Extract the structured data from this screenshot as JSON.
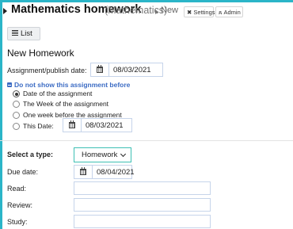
{
  "header": {
    "title": "Mathematics homework",
    "subject": "(Mathematics)",
    "crumb": "New",
    "settings_label": "Settings",
    "admin_label": "Admin",
    "settings_icon": "wrench-icon",
    "admin_icon": "users-icon"
  },
  "toolbar": {
    "list_label": "List"
  },
  "form": {
    "section_title": "New Homework",
    "publish_label": "Assignment/publish date:",
    "publish_date": "08/03/2021",
    "visibility_toggle": "Do not show this assignment before",
    "visibility_options": [
      {
        "label": "Date of the assignment",
        "checked": true
      },
      {
        "label": "The Week of the assignment",
        "checked": false
      },
      {
        "label": "One week before the assignment",
        "checked": false
      },
      {
        "label": "This Date:",
        "checked": false
      }
    ],
    "this_date_value": "08/03/2021",
    "type_label": "Select a type:",
    "type_value": "Homework",
    "due_label": "Due date:",
    "due_date": "08/04/2021",
    "read_label": "Read:",
    "review_label": "Review:",
    "study_label": "Study:"
  },
  "colors": {
    "accent": "#2bb5c8",
    "link": "#3c6cc4",
    "select_border": "#3ec0b4"
  }
}
